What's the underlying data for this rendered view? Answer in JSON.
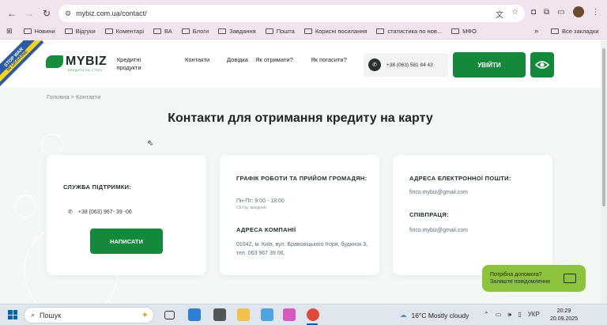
{
  "browser": {
    "url": "mybiz.com.ua/contact/",
    "bookmarks": [
      "Новини",
      "Відгуки",
      "Коментарі",
      "ВА",
      "Блоги",
      "Завдання",
      "Пошта",
      "Корисні посилання",
      "статистика по нов...",
      "МФО"
    ],
    "bookmarks_more": "»",
    "all_bookmarks": "Все закладки"
  },
  "ribbon": {
    "line1": "STOP WAR",
    "line2": "IN UKRAINE"
  },
  "header": {
    "logo_text": "MYBIZ",
    "logo_tagline": "КРЕДИТИ ПО СТОЛІ",
    "nav": {
      "credit_products": "Кредитні продукти",
      "contacts": "Контакти",
      "help": "Довідка",
      "how_to_get": "Як отримати?",
      "how_to_repay": "Як погасити?"
    },
    "phone": "+38 (063) 581 84 43",
    "login_label": "УВІЙТИ"
  },
  "breadcrumb": {
    "home": "Головна",
    "separator": ">",
    "current": "Контакти"
  },
  "page_title": "Контакти для отримання кредиту на карту",
  "support_card": {
    "heading": "СЛУЖБА ПІДТРИМКИ:",
    "phone": "+38 (063) 967- 39 -06",
    "write_label": "НАПИСАТИ"
  },
  "schedule_card": {
    "heading": "ГРАФІК РОБОТИ ТА ПРИЙОМ ГРОМАДЯН:",
    "hours": "Пн-Пт: 9:00 - 18:00",
    "weekend": "Сб-Нд: вихідний",
    "address_heading": "АДРЕСА КОМПАНІЇ",
    "address": "01042, м. Київ, вул. Бравовіцького Ігоря, будинок 3, тел. 063 967 39 06,"
  },
  "email_card": {
    "heading": "АДРЕСА ЕЛЕКТРОННОЇ ПОШТИ:",
    "email": "finco.mybiz@gmail.com",
    "cooperation_heading": "СПІВПРАЦЯ:",
    "cooperation_email": "finco.mybiz@gmail.com"
  },
  "help_widget": {
    "line1": "Потрібна допомога?",
    "line2": "Залиште повідомлення"
  },
  "taskbar": {
    "search_placeholder": "Пошук",
    "weather": "16°C  Mostly cloudy",
    "language": "УКР",
    "time": "20:29",
    "date": "20.09.2025"
  },
  "colors": {
    "brand_green": "#15893a",
    "help_green": "#8dc33c",
    "page_bg": "#f3f8f4"
  }
}
